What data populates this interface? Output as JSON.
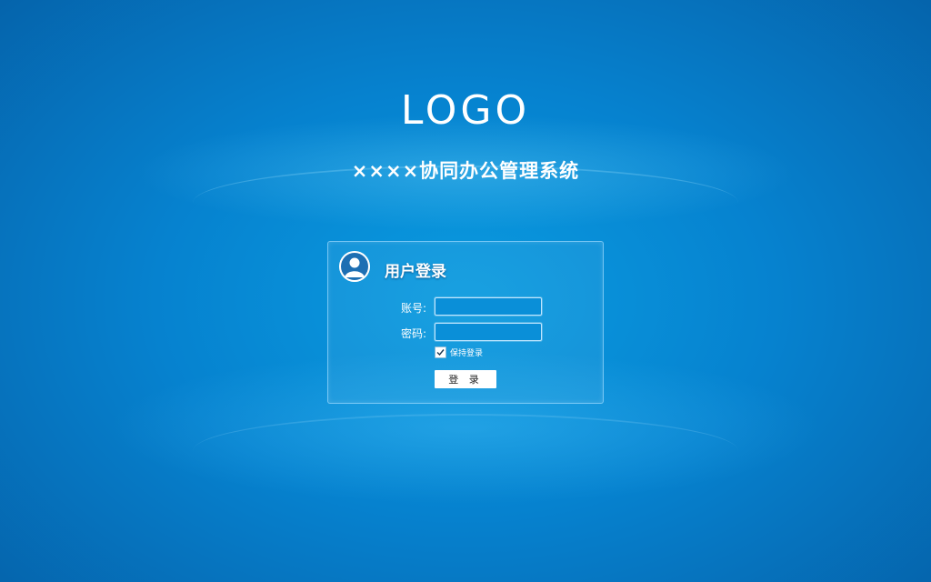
{
  "header": {
    "logo_text": "LOGO",
    "system_title": "××××协同办公管理系统"
  },
  "login": {
    "title": "用户登录",
    "account_label": "账号:",
    "account_value": "",
    "password_label": "密码:",
    "password_value": "",
    "remember_label": "保持登录",
    "remember_checked": true,
    "submit_label": "登 录"
  },
  "colors": {
    "background_center": "#0a9be0",
    "background_edge": "#055fa6",
    "panel_border": "#a0dcff",
    "text": "#ffffff"
  },
  "icons": {
    "avatar": "user-avatar-icon",
    "checkbox": "checkmark-icon"
  }
}
